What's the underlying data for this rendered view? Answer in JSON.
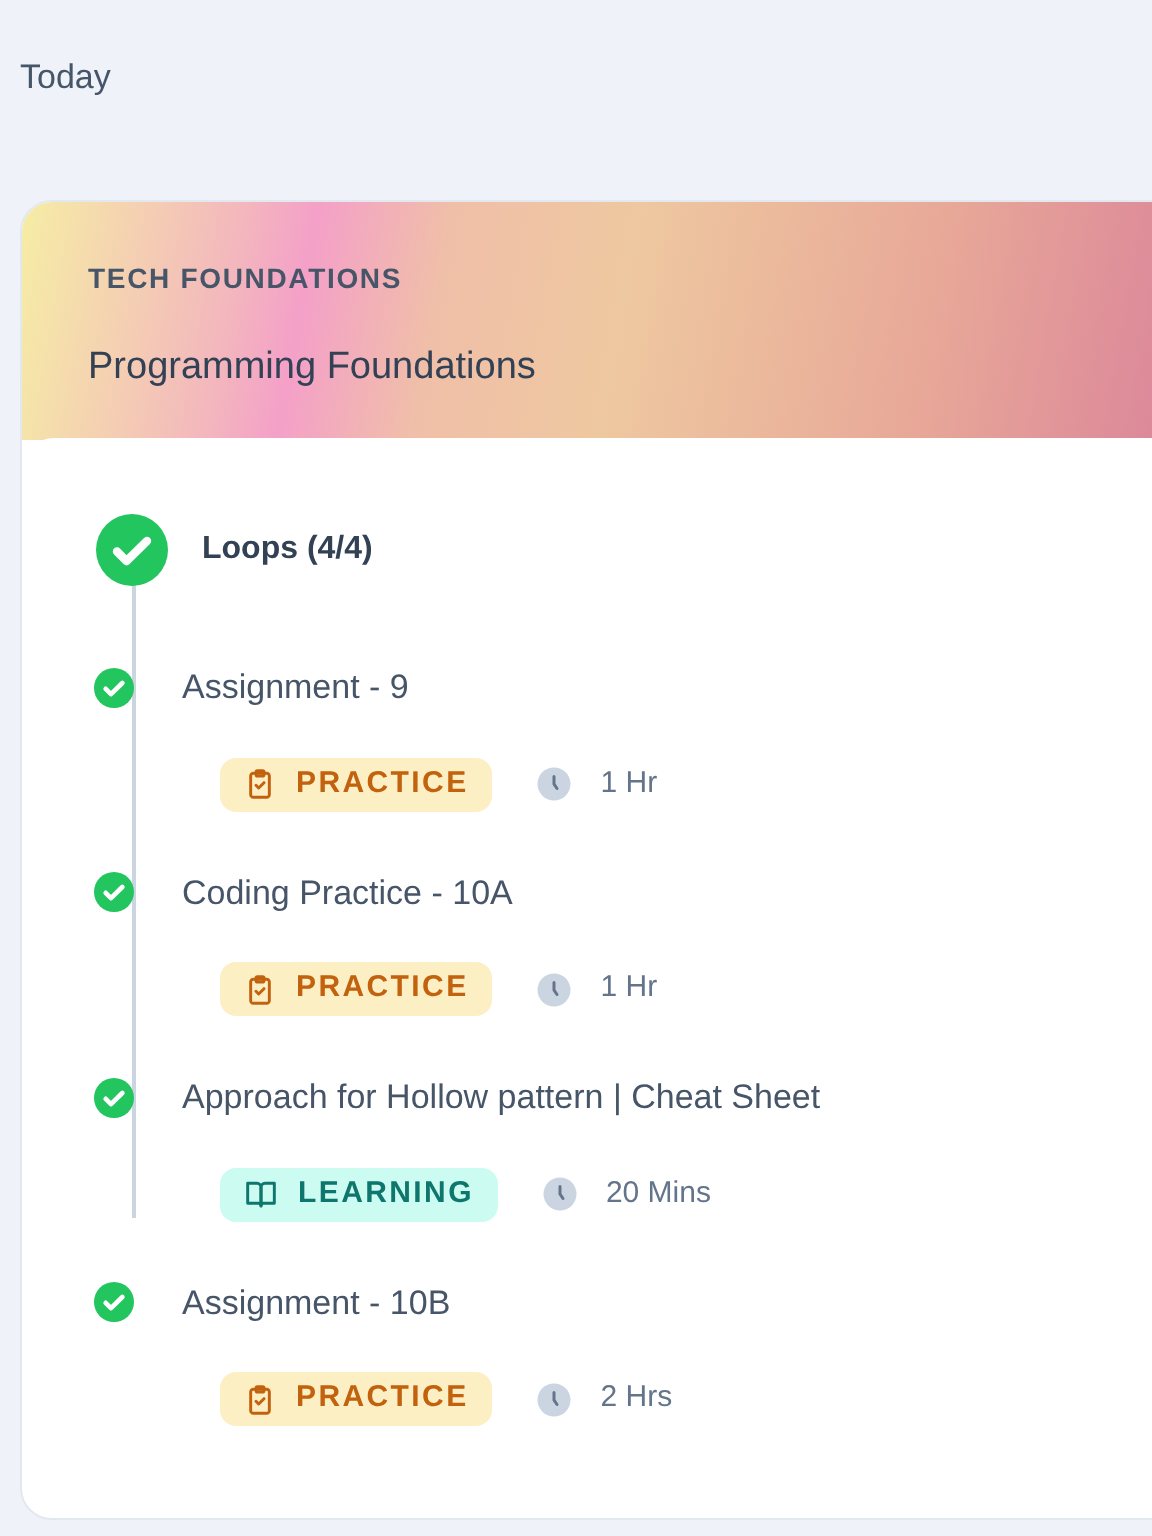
{
  "date_heading": "Today",
  "course": {
    "category": "TECH FOUNDATIONS",
    "title": "Programming Foundations"
  },
  "module": {
    "title": "Loops (4/4)",
    "completed": true
  },
  "items": [
    {
      "title": "Assignment - 9",
      "completed": true,
      "kind": "practice",
      "tag": "PRACTICE",
      "duration": "1 Hr"
    },
    {
      "title": "Coding Practice - 10A",
      "completed": true,
      "kind": "practice",
      "tag": "PRACTICE",
      "duration": "1 Hr"
    },
    {
      "title": "Approach for Hollow pattern | Cheat Sheet",
      "completed": true,
      "kind": "learning",
      "tag": "LEARNING",
      "duration": "20 Mins"
    },
    {
      "title": "Assignment - 10B",
      "completed": true,
      "kind": "practice",
      "tag": "PRACTICE",
      "duration": "2 Hrs"
    }
  ]
}
